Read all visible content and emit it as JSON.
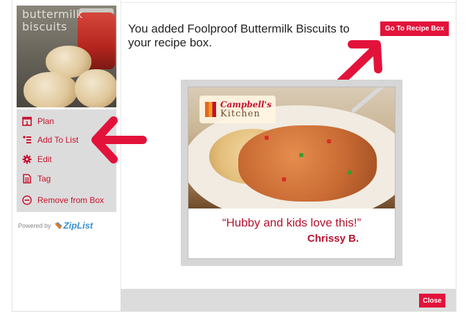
{
  "sidebar": {
    "thumbnail": {
      "overlay_text": "buttermilk\nbiscuits"
    },
    "menu": [
      {
        "label": "Plan",
        "icon": "calendar-icon"
      },
      {
        "label": "Add To List",
        "icon": "add-list-icon"
      },
      {
        "label": "Edit",
        "icon": "gear-icon"
      },
      {
        "label": "Tag",
        "icon": "tag-document-icon"
      },
      {
        "label": "Remove from Box",
        "icon": "minus-circle-icon"
      }
    ],
    "powered_by": "Powered by",
    "ziplist": "ZipList"
  },
  "main": {
    "message": "You added Foolproof Buttermilk Biscuits to your recipe box.",
    "goto_button": "Go To Recipe Box",
    "close_button": "Close"
  },
  "ad": {
    "brand": "Campbell's",
    "brand_sub": "Kitchen",
    "quote": "“Hubby and kids love this!”",
    "author": "Chrissy B."
  },
  "colors": {
    "accent_red": "#e3123b",
    "link_red": "#c7102e",
    "menu_bg": "#dcdcdc",
    "ziplist_blue": "#3a8fd0"
  }
}
